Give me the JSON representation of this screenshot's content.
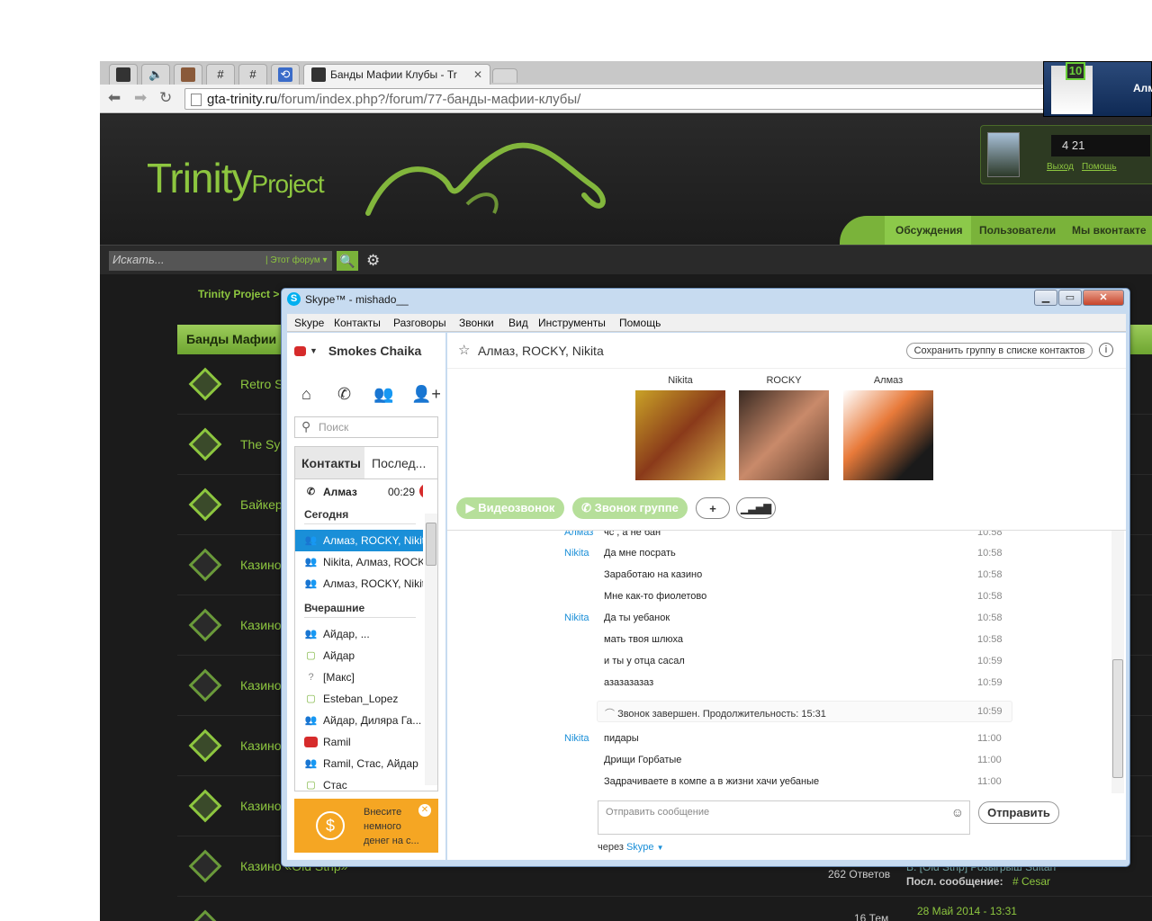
{
  "browser": {
    "tabs": [
      {
        "label": "",
        "icon": "site-icon"
      },
      {
        "label": "",
        "icon": "speaker-icon"
      },
      {
        "label": "",
        "icon": "avatar-icon"
      },
      {
        "label": "#",
        "icon": "hash-icon"
      },
      {
        "label": "#",
        "icon": "hash-icon"
      },
      {
        "label": "",
        "icon": "refresh-page-icon"
      },
      {
        "label": "Банды Мафии Клубы - Tr",
        "icon": "site-icon"
      }
    ],
    "url_host": "gta-trinity.ru",
    "url_path": "/forum/index.php?/forum/77-банды-мафии-клубы/"
  },
  "site": {
    "logo_main": "Trinity",
    "logo_sub": "Project",
    "user_counter": "4 21",
    "logout": "Выход",
    "help": "Помощь",
    "nav": [
      "Обсуждения",
      "Пользователи",
      "Мы вконтакте"
    ],
    "search_placeholder": "Искать...",
    "search_scope": "Этот форум",
    "breadcrumb": "Trinity Project",
    "forum_title": "Банды Мафии",
    "rows": [
      {
        "title": "Retro S"
      },
      {
        "title": "The Sy"
      },
      {
        "title": "Байкер"
      },
      {
        "title": "Казино"
      },
      {
        "title": "Казино"
      },
      {
        "title": "Казино"
      },
      {
        "title": "Казино"
      },
      {
        "title": "Казино"
      },
      {
        "title": "Казино «Old Strip»"
      }
    ],
    "last_row": {
      "replies": "262 Ответов",
      "lastpost_topic": "В: [Old Strip] Розыгрыш Sultan",
      "lastpost_label": "Посл. сообщение:",
      "lastpost_user": "# Cesar",
      "next_count": "16 Тем",
      "next_date": "28 Май 2014 - 13:31"
    }
  },
  "overlay": {
    "badge": "10",
    "name": "Алм"
  },
  "skype": {
    "title": "Skype™ - mishado__",
    "menu": [
      "Skype",
      "Контакты",
      "Разговоры",
      "Звонки",
      "Вид",
      "Инструменты",
      "Помощь"
    ],
    "status_name": "Smokes Chaika",
    "search_placeholder": "Поиск",
    "tabs": [
      "Контакты",
      "Послед..."
    ],
    "active_call": {
      "name": "Алмаз",
      "time": "00:29"
    },
    "sections": [
      "Сегодня",
      "Вчерашние"
    ],
    "today": [
      "Алмаз, ROCKY, Nikita",
      "Nikita, Алмаз, ROCKY",
      "Алмаз, ROCKY, Nikita"
    ],
    "yesterday": [
      {
        "name": "Айдар, ...",
        "icon": "group-icon"
      },
      {
        "name": "Айдар",
        "icon": "online-icon"
      },
      {
        "name": "[Макс]",
        "icon": "unknown-icon"
      },
      {
        "name": "Esteban_Lopez",
        "icon": "online-icon"
      },
      {
        "name": "Айдар, Диляра Га...",
        "icon": "group-icon"
      },
      {
        "name": "Ramil",
        "icon": "offline-icon"
      },
      {
        "name": "Ramil, Стас, Айдар",
        "icon": "group-icon"
      },
      {
        "name": "Стас",
        "icon": "online-icon"
      }
    ],
    "promo": "Внесите немного денег на с...",
    "chat_title": "Алмаз, ROCKY, Nikita",
    "save_group": "Сохранить группу в списке контактов",
    "participants": [
      "Nikita",
      "ROCKY",
      "Алмаз"
    ],
    "video_call": "Видеозвонок",
    "group_call": "Звонок группе",
    "messages": [
      {
        "who": "Алмаз",
        "text": "чс , а не бан",
        "time": "10:58"
      },
      {
        "who": "Nikita",
        "text": "Да мне посрать",
        "time": "10:58"
      },
      {
        "who": "",
        "text": "Заработаю на казино",
        "time": "10:58"
      },
      {
        "who": "",
        "text": "Мне как-то фиолетово",
        "time": "10:58"
      },
      {
        "who": "Nikita",
        "text": "Да ты уебанок",
        "time": "10:58"
      },
      {
        "who": "",
        "text": "мать твоя шлюха",
        "time": "10:58"
      },
      {
        "who": "",
        "text": "и ты у отца сасал",
        "time": "10:59"
      },
      {
        "who": "",
        "text": "азазазазаз",
        "time": "10:59"
      }
    ],
    "call_ended": "Звонок завершен. Продолжительность: 15:31",
    "call_ended_time": "10:59",
    "messages2": [
      {
        "who": "Nikita",
        "text": "пидары",
        "time": "11:00"
      },
      {
        "who": "",
        "text": "Дрищи Горбатые",
        "time": "11:00"
      },
      {
        "who": "",
        "text": "Задрачиваете в компе а в жизни хачи уебаные",
        "time": "11:00"
      }
    ],
    "input_placeholder": "Отправить сообщение",
    "send": "Отправить",
    "via_label": "через",
    "via_value": "Skype"
  }
}
